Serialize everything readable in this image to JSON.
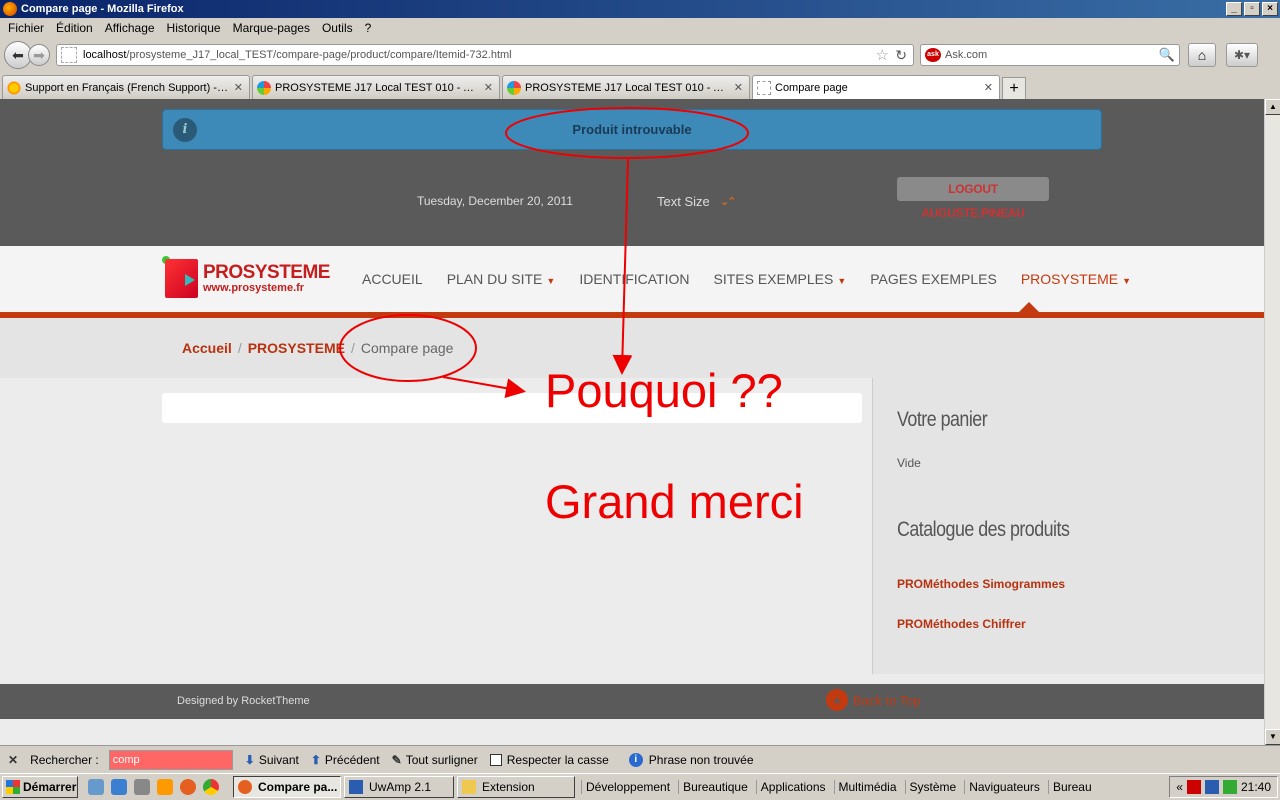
{
  "window": {
    "title": "Compare page - Mozilla Firefox"
  },
  "menubar": [
    "Fichier",
    "Édition",
    "Affichage",
    "Historique",
    "Marque-pages",
    "Outils",
    "?"
  ],
  "urlbar": {
    "host": "localhost",
    "path": "/prosysteme_J17_local_TEST/compare-page/product/compare/Itemid-732.html"
  },
  "searchbar": {
    "engine": "Ask.com"
  },
  "tabs": [
    {
      "label": "Support en Français (French Support) - Hi...",
      "icon": "sun"
    },
    {
      "label": "PROSYSTEME J17 Local TEST 010 - Ad...",
      "icon": "joomla"
    },
    {
      "label": "PROSYSTEME J17 Local TEST 010 - Ad...",
      "icon": "joomla"
    },
    {
      "label": "Compare page",
      "icon": "blank"
    }
  ],
  "page": {
    "alert": "Produit introuvable",
    "date": "Tuesday, December 20, 2011",
    "text_size_label": "Text Size",
    "logout": "LOGOUT AUGUSTE.PINEAU",
    "logo_title": "PROSYSTEME",
    "logo_sub": "www.prosysteme.fr",
    "menu": [
      {
        "label": "ACCUEIL",
        "dropdown": false
      },
      {
        "label": "PLAN DU SITE",
        "dropdown": true
      },
      {
        "label": "IDENTIFICATION",
        "dropdown": false
      },
      {
        "label": "SITES EXEMPLES",
        "dropdown": true
      },
      {
        "label": "PAGES EXEMPLES",
        "dropdown": false
      },
      {
        "label": "PROSYSTEME",
        "dropdown": true
      }
    ],
    "breadcrumbs": [
      "Accueil",
      "PROSYSTEME",
      "Compare page"
    ],
    "panier_title_a": "Votre",
    "panier_title_b": "panier",
    "panier_value": "Vide",
    "catalogue_title_a": "Catalogue",
    "catalogue_title_b": "des produits",
    "catalogue_links": [
      "PROMéthodes Simogrammes",
      "PROMéthodes Chiffrer"
    ],
    "designed_by": "Designed by RocketTheme",
    "back_to_top": "Back to Top"
  },
  "annotations": {
    "question": "Pouquoi ??",
    "thanks": "Grand merci"
  },
  "findbar": {
    "label": "Rechercher :",
    "value": "comp",
    "next": "Suivant",
    "previous": "Précédent",
    "highlight": "Tout surligner",
    "match_case": "Respecter la casse",
    "status": "Phrase non trouvée"
  },
  "taskbar": {
    "start": "Démarrer",
    "tasks": [
      "Compare pa...",
      "UwAmp 2.1",
      "Extension"
    ],
    "toolbars": [
      "Développement",
      "Bureautique",
      "Applications",
      "Multimédia",
      "Système",
      "Naviguateurs",
      "Bureau"
    ],
    "clock": "21:40"
  },
  "colors": {
    "accent": "#c33a10",
    "annotation": "#e00000",
    "alert_bg": "#3d8ab9"
  }
}
